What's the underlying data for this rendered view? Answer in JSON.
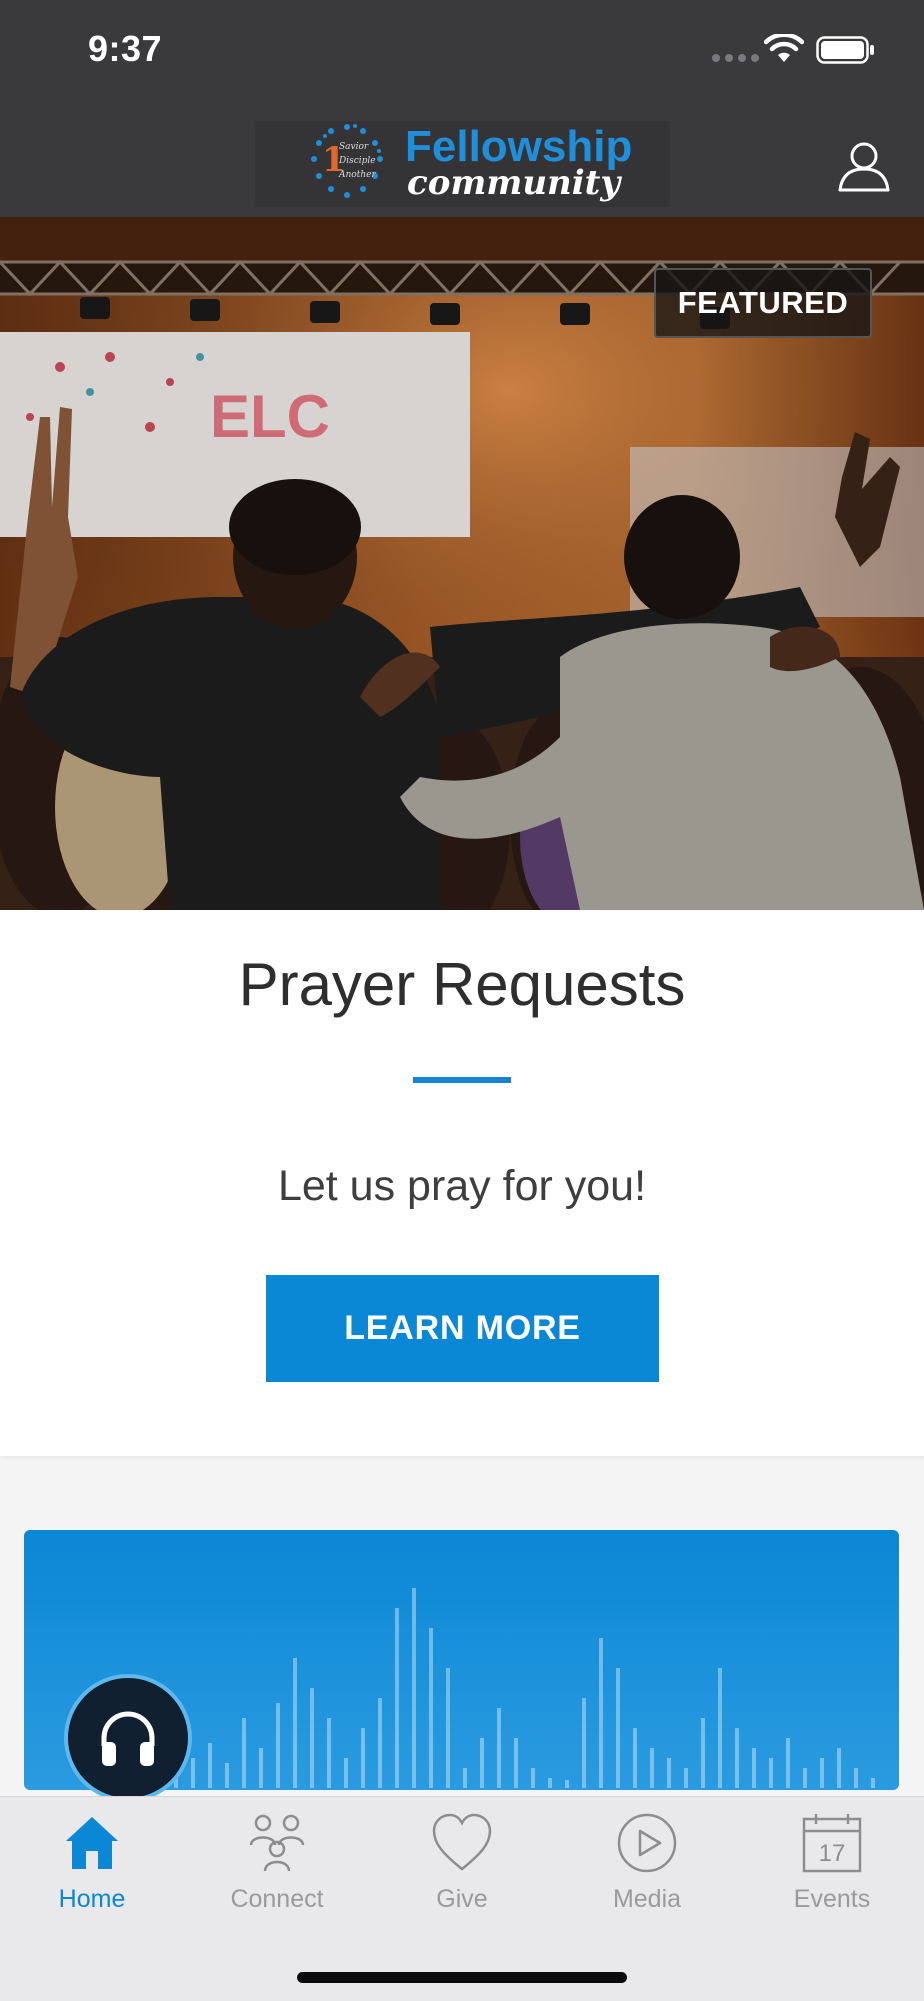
{
  "status_bar": {
    "time": "9:37"
  },
  "header": {
    "logo": {
      "title": "Fellowship",
      "subtitle": "community",
      "mark_lines": [
        "Savior",
        "Disciple",
        "Another"
      ],
      "mark_number": "1"
    },
    "profile_icon": "person-outline-icon"
  },
  "hero": {
    "badge": "FEATURED",
    "image": "people-praying-photo"
  },
  "card": {
    "title": "Prayer Requests",
    "subtitle": "Let us pray for you!",
    "button": "LEARN MORE"
  },
  "audio_player": {
    "icon": "headphones-icon"
  },
  "tabs": [
    {
      "label": "Home",
      "icon": "home-icon",
      "active": true
    },
    {
      "label": "Connect",
      "icon": "people-icon",
      "active": false
    },
    {
      "label": "Give",
      "icon": "heart-icon",
      "active": false
    },
    {
      "label": "Media",
      "icon": "play-circle-icon",
      "active": false
    },
    {
      "label": "Events",
      "icon": "calendar-icon",
      "active": false,
      "calendar_day": "17"
    }
  ],
  "colors": {
    "accent": "#0a87d5",
    "header_bg": "#3a3a3c",
    "tab_inactive": "#9a9a9c"
  }
}
